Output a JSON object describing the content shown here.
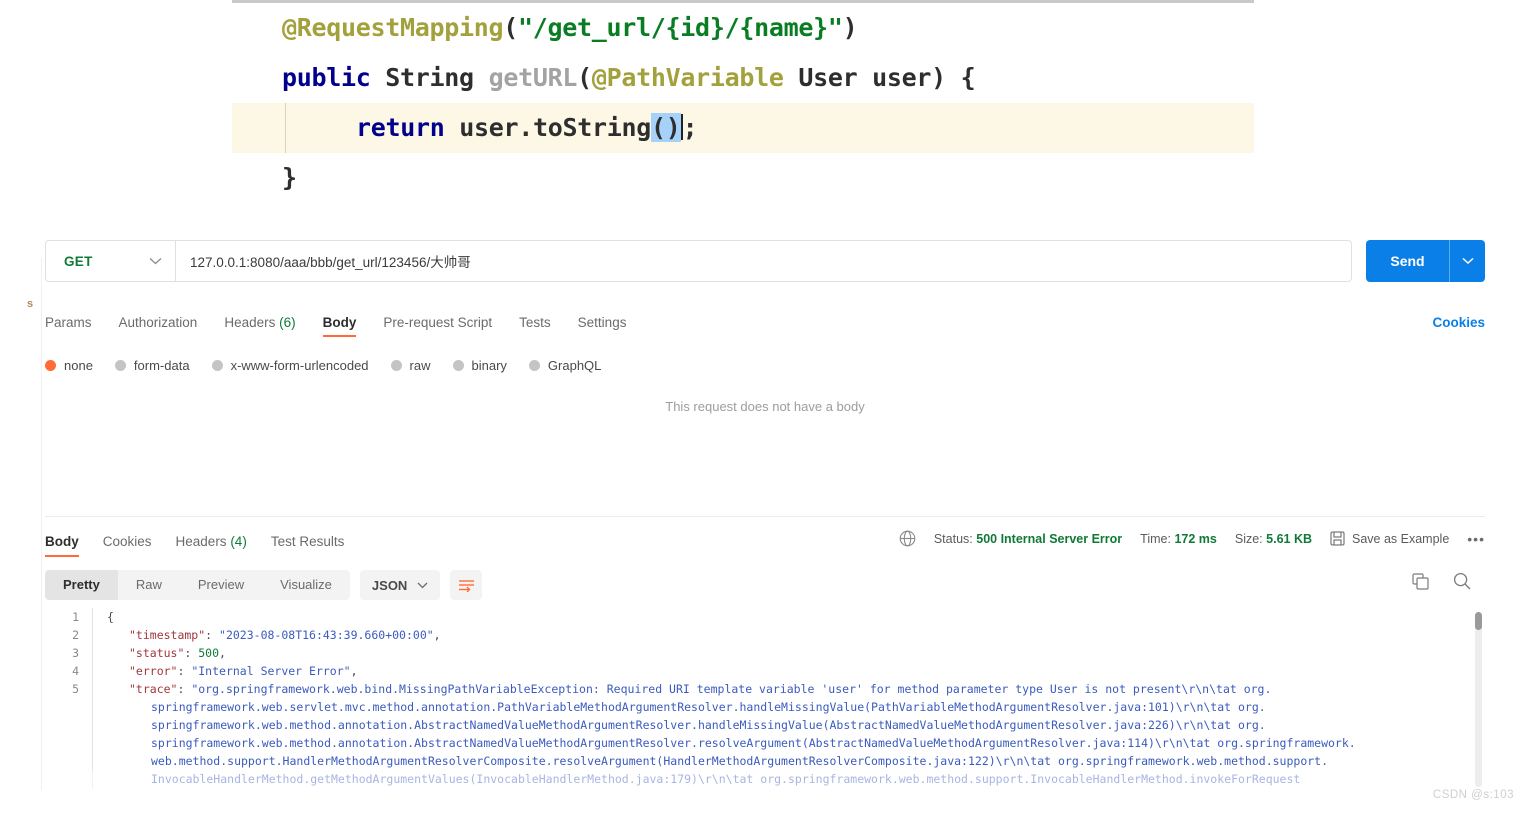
{
  "code_snippet": {
    "lines": [
      {
        "id": "line-annotation",
        "highlight": false,
        "tokens": [
          {
            "cls": "c-anno",
            "t": "@RequestMapping"
          },
          {
            "cls": "c-plain",
            "t": "("
          },
          {
            "cls": "c-str",
            "t": "\"/get_url/{id}/{name}\""
          },
          {
            "cls": "c-plain",
            "t": ")"
          }
        ]
      },
      {
        "id": "line-signature",
        "highlight": false,
        "tokens": [
          {
            "cls": "c-kw",
            "t": "public"
          },
          {
            "cls": "c-plain",
            "t": " "
          },
          {
            "cls": "c-type",
            "t": "String"
          },
          {
            "cls": "c-plain",
            "t": " "
          },
          {
            "cls": "c-meth",
            "t": "getURL"
          },
          {
            "cls": "c-plain",
            "t": "("
          },
          {
            "cls": "c-anno",
            "t": "@PathVariable"
          },
          {
            "cls": "c-plain",
            "t": " User user) {"
          }
        ]
      },
      {
        "id": "line-return",
        "highlight": true,
        "tokens": [
          {
            "cls": "c-kw",
            "t": "return"
          },
          {
            "cls": "c-plain",
            "t": " user.toString"
          },
          {
            "cls": "c-sel",
            "t": "()"
          },
          {
            "cls": "c-plain",
            "t": ";"
          }
        ]
      },
      {
        "id": "line-close-brace",
        "highlight": false,
        "tokens": [
          {
            "cls": "c-plain",
            "t": "}"
          }
        ]
      }
    ]
  },
  "request": {
    "method": "GET",
    "url": "127.0.0.1:8080/aaa/bbb/get_url/123456/大帅哥",
    "send_label": "Send",
    "cookies_label": "Cookies",
    "tabs": [
      {
        "label": "Params",
        "active": false,
        "count": ""
      },
      {
        "label": "Authorization",
        "active": false,
        "count": ""
      },
      {
        "label": "Headers",
        "active": false,
        "count": "(6)"
      },
      {
        "label": "Body",
        "active": true,
        "count": ""
      },
      {
        "label": "Pre-request Script",
        "active": false,
        "count": ""
      },
      {
        "label": "Tests",
        "active": false,
        "count": ""
      },
      {
        "label": "Settings",
        "active": false,
        "count": ""
      }
    ],
    "body_types": [
      {
        "label": "none",
        "selected": true
      },
      {
        "label": "form-data",
        "selected": false
      },
      {
        "label": "x-www-form-urlencoded",
        "selected": false
      },
      {
        "label": "raw",
        "selected": false
      },
      {
        "label": "binary",
        "selected": false
      },
      {
        "label": "GraphQL",
        "selected": false
      }
    ],
    "empty_body_text": "This request does not have a body"
  },
  "response": {
    "tabs": [
      {
        "label": "Body",
        "active": true,
        "count": ""
      },
      {
        "label": "Cookies",
        "active": false,
        "count": ""
      },
      {
        "label": "Headers",
        "active": false,
        "count": "(4)"
      },
      {
        "label": "Test Results",
        "active": false,
        "count": ""
      }
    ],
    "status_label": "Status:",
    "status_value": "500 Internal Server Error",
    "time_label": "Time:",
    "time_value": "172 ms",
    "size_label": "Size:",
    "size_value": "5.61 KB",
    "save_example_label": "Save as Example",
    "more_label": "•••",
    "formats": [
      {
        "label": "Pretty",
        "active": true
      },
      {
        "label": "Raw",
        "active": false
      },
      {
        "label": "Preview",
        "active": false
      },
      {
        "label": "Visualize",
        "active": false
      }
    ],
    "language": "JSON",
    "body_lines": [
      {
        "num": "1",
        "indent": 0,
        "segs": [
          {
            "cls": "p",
            "t": "{"
          }
        ]
      },
      {
        "num": "2",
        "indent": 1,
        "segs": [
          {
            "cls": "k",
            "t": "\"timestamp\""
          },
          {
            "cls": "p",
            "t": ": "
          },
          {
            "cls": "s",
            "t": "\"2023-08-08T16:43:39.660+00:00\""
          },
          {
            "cls": "p",
            "t": ","
          }
        ]
      },
      {
        "num": "3",
        "indent": 1,
        "segs": [
          {
            "cls": "k",
            "t": "\"status\""
          },
          {
            "cls": "p",
            "t": ": "
          },
          {
            "cls": "n",
            "t": "500"
          },
          {
            "cls": "p",
            "t": ","
          }
        ]
      },
      {
        "num": "4",
        "indent": 1,
        "segs": [
          {
            "cls": "k",
            "t": "\"error\""
          },
          {
            "cls": "p",
            "t": ": "
          },
          {
            "cls": "s",
            "t": "\"Internal Server Error\""
          },
          {
            "cls": "p",
            "t": ","
          }
        ]
      },
      {
        "num": "5",
        "indent": 1,
        "segs": [
          {
            "cls": "k",
            "t": "\"trace\""
          },
          {
            "cls": "p",
            "t": ": "
          },
          {
            "cls": "s",
            "t": "\"org.springframework.web.bind.MissingPathVariableException: Required URI template variable 'user' for method parameter type User is not present\\r\\n\\tat org."
          }
        ]
      },
      {
        "num": "",
        "indent": 2,
        "segs": [
          {
            "cls": "cont",
            "t": "springframework.web.servlet.mvc.method.annotation.PathVariableMethodArgumentResolver.handleMissingValue(PathVariableMethodArgumentResolver.java:101)\\r\\n\\tat org."
          }
        ]
      },
      {
        "num": "",
        "indent": 2,
        "segs": [
          {
            "cls": "cont",
            "t": "springframework.web.method.annotation.AbstractNamedValueMethodArgumentResolver.handleMissingValue(AbstractNamedValueMethodArgumentResolver.java:226)\\r\\n\\tat org."
          }
        ]
      },
      {
        "num": "",
        "indent": 2,
        "segs": [
          {
            "cls": "cont",
            "t": "springframework.web.method.annotation.AbstractNamedValueMethodArgumentResolver.resolveArgument(AbstractNamedValueMethodArgumentResolver.java:114)\\r\\n\\tat org.springframework."
          }
        ]
      },
      {
        "num": "",
        "indent": 2,
        "segs": [
          {
            "cls": "cont",
            "t": "web.method.support.HandlerMethodArgumentResolverComposite.resolveArgument(HandlerMethodArgumentResolverComposite.java:122)\\r\\n\\tat org.springframework.web.method.support."
          }
        ]
      },
      {
        "num": "",
        "indent": 2,
        "segs": [
          {
            "cls": "cont",
            "t": "InvocableHandlerMethod.getMethodArgumentValues(InvocableHandlerMethod.java:179)\\r\\n\\tat org.springframework.web.method.support.InvocableHandlerMethod.invokeForRequest"
          }
        ]
      }
    ]
  },
  "watermark": "CSDN @s:103",
  "stray_glyph": "s",
  "colors": {
    "accent_orange": "#ff6c37",
    "send_blue": "#0b7fe8",
    "status_green": "#0f7a38",
    "json_key_red": "#a3373b",
    "json_string_blue": "#3b5bbf"
  }
}
